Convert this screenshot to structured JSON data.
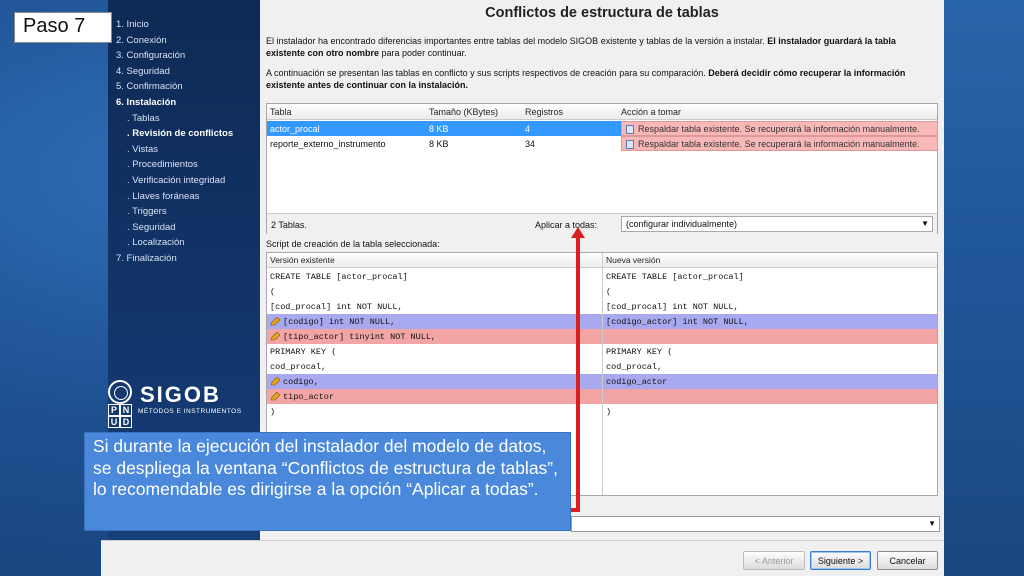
{
  "slide": {
    "step_label": "Paso 7"
  },
  "sidebar": {
    "items": [
      {
        "label": "1. Inicio",
        "bold": false,
        "sub": false
      },
      {
        "label": "2. Conexión",
        "bold": false,
        "sub": false
      },
      {
        "label": "3. Configuración",
        "bold": false,
        "sub": false
      },
      {
        "label": "4. Seguridad",
        "bold": false,
        "sub": false
      },
      {
        "label": "5. Confirmación",
        "bold": false,
        "sub": false
      },
      {
        "label": "6. Instalación",
        "bold": true,
        "sub": false
      },
      {
        "label": ". Tablas",
        "bold": false,
        "sub": true
      },
      {
        "label": ". Revisión de conflictos",
        "bold": true,
        "sub": true
      },
      {
        "label": ". Vistas",
        "bold": false,
        "sub": true
      },
      {
        "label": ". Procedimientos",
        "bold": false,
        "sub": true
      },
      {
        "label": ". Verificación integridad",
        "bold": false,
        "sub": true
      },
      {
        "label": ". Llaves foráneas",
        "bold": false,
        "sub": true
      },
      {
        "label": ". Triggers",
        "bold": false,
        "sub": true
      },
      {
        "label": ". Seguridad",
        "bold": false,
        "sub": true
      },
      {
        "label": ". Localización",
        "bold": false,
        "sub": true
      },
      {
        "label": "7. Finalización",
        "bold": false,
        "sub": false
      }
    ],
    "logo": {
      "name": "SIGOB",
      "subtitle": "MÉTODOS E INSTRUMENTOS",
      "pnud_letters": [
        "P",
        "N",
        "U",
        "D"
      ]
    }
  },
  "main": {
    "title": "Conflictos de estructura de tablas",
    "para1_normal": "El instalador ha encontrado diferencias importantes entre tablas del modelo SIGOB existente y tablas de la versión a instalar. ",
    "para1_bold": "El instalador guardará la tabla existente con otro nombre",
    "para1_end": " para poder continuar.",
    "para2_normal": "A continuación se presentan las tablas en conflicto y sus scripts respectivos de creación para su comparación. ",
    "para2_bold": "Deberá decidir cómo recuperar la información existente antes de continuar con la instalación.",
    "table": {
      "headers": [
        "Tabla",
        "Tamaño (KBytes)",
        "Registros",
        "Acción a tomar"
      ],
      "rows": [
        {
          "tabla": "actor_procal",
          "size": "8 KB",
          "registros": "4",
          "accion": "Respaldar tabla existente. Se recuperará la información manualmente.",
          "selected": true
        },
        {
          "tabla": "reporte_externo_instrumento",
          "size": "8 KB",
          "registros": "34",
          "accion": "Respaldar tabla existente. Se recuperará la información manualmente.",
          "selected": false
        }
      ],
      "count_label": "2 Tablas.",
      "apply_label": "Aplicar a todas:",
      "apply_value": "(configurar individualmente)"
    },
    "script_label": "Script de creación de la tabla seleccionada:",
    "scripts": {
      "left_header": "Versión existente",
      "right_header": "Nueva versión",
      "left_lines": [
        {
          "text": "CREATE TABLE [actor_procal]",
          "style": ""
        },
        {
          "text": "(",
          "style": ""
        },
        {
          "text": "[cod_procal] int NOT NULL,",
          "style": ""
        },
        {
          "text": "[codigo] int NOT NULL,",
          "style": "blue"
        },
        {
          "text": "[tipo_actor] tinyint NOT NULL,",
          "style": "pink"
        },
        {
          "text": "PRIMARY KEY (",
          "style": ""
        },
        {
          "text": "cod_procal,",
          "style": ""
        },
        {
          "text": "codigo,",
          "style": "blue"
        },
        {
          "text": "tipo_actor",
          "style": "pink"
        },
        {
          "text": ")",
          "style": ""
        }
      ],
      "right_lines": [
        {
          "text": "CREATE TABLE [actor_procal]",
          "style": ""
        },
        {
          "text": "(",
          "style": ""
        },
        {
          "text": "[cod_procal] int NOT NULL,",
          "style": ""
        },
        {
          "text": "[codigo_actor] int NOT NULL,",
          "style": "blue"
        },
        {
          "text": "",
          "style": "pink"
        },
        {
          "text": "PRIMARY KEY (",
          "style": ""
        },
        {
          "text": "cod_procal,",
          "style": ""
        },
        {
          "text": "codigo_actor",
          "style": "blue"
        },
        {
          "text": "",
          "style": "pink"
        },
        {
          "text": ")",
          "style": ""
        }
      ]
    }
  },
  "buttons": {
    "back": "< Anterior",
    "next": "Siguiente >",
    "cancel": "Cancelar"
  },
  "callout": {
    "text": "Si durante la ejecución del instalador del modelo de datos, se despliega la ventana “Conflictos de estructura de tablas”, lo recomendable es dirigirse a la opción “Aplicar a todas”."
  },
  "colors": {
    "selection": "#3399ff",
    "conflict_pink": "#f3a5a5",
    "diff_blue": "#a9a9f0",
    "arrow_red": "#d91f1f",
    "callout_blue": "#4a88dc"
  }
}
